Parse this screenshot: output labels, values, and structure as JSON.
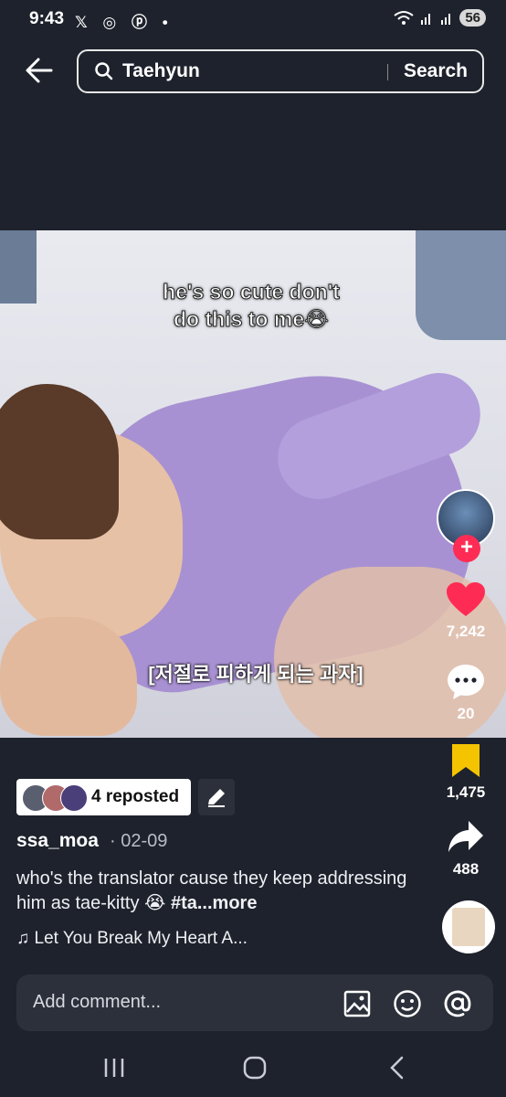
{
  "status": {
    "time": "9:43",
    "apps": "𝕏 ◎ ⓟ •",
    "battery": "56"
  },
  "search": {
    "query": "Taehyun",
    "button": "Search"
  },
  "video": {
    "caption_line1": "he's so cute don't",
    "caption_line2": "do this to me😭",
    "subtitle": "[저절로 피하게 되는 과자]"
  },
  "rail": {
    "likes": "7,242",
    "comments": "20",
    "saves": "1,475",
    "shares": "488",
    "follow": "+"
  },
  "post": {
    "repost_label": "4 reposted",
    "username": "ssa_moa",
    "date": "· 02-09",
    "description": "who's the translator cause they keep addressing him as tae-kitty 😭 ",
    "hashtag": "#ta...",
    "more": "more",
    "music": "♫ Let You Break My Heart A..."
  },
  "comment": {
    "placeholder": "Add comment..."
  },
  "colors": {
    "accent": "#fe2c55",
    "save": "#f5c400",
    "background": "#1e222c"
  }
}
